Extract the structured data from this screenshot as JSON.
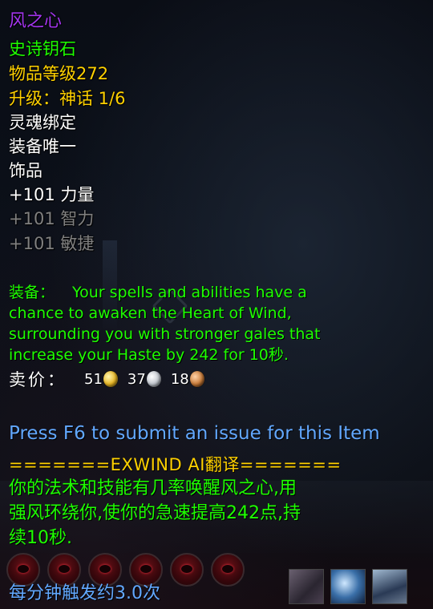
{
  "tooltip": {
    "item_name": "风之心",
    "item_type": "史诗钥石",
    "item_level": "物品等级272",
    "upgrade": "升级：神话 1/6",
    "binding": "灵魂绑定",
    "unique": "装备唯一",
    "slot": "饰品",
    "stats": [
      "+101 力量",
      "+101 智力",
      "+101 敏捷"
    ],
    "equip_label": "装备：",
    "equip_lines": [
      "Your spells and abilities have a",
      "chance to awaken the Heart of Wind,",
      "surrounding you with stronger gales that",
      "increase your Haste by 242 for 10秒."
    ],
    "sell_label": "卖价：",
    "sell_gold": "51",
    "sell_silver": "37",
    "sell_copper": "18"
  },
  "addon": {
    "hint": "Press F6 to submit an issue for this Item",
    "separator": "=======EXWIND AI翻译=======",
    "translation_lines": [
      "你的法术和技能有几率唤醒风之心,用",
      "强风环绕你,使你的急速提高242点,持",
      "续10秒."
    ],
    "proc_rate": "每分钟触发约3.0次"
  },
  "colors": {
    "epic": "#a335ee",
    "uncommon": "#1eff00",
    "gold": "#ffd100",
    "white": "#ffffff",
    "inactive": "#808080",
    "blue_text": "#62a8ff"
  }
}
